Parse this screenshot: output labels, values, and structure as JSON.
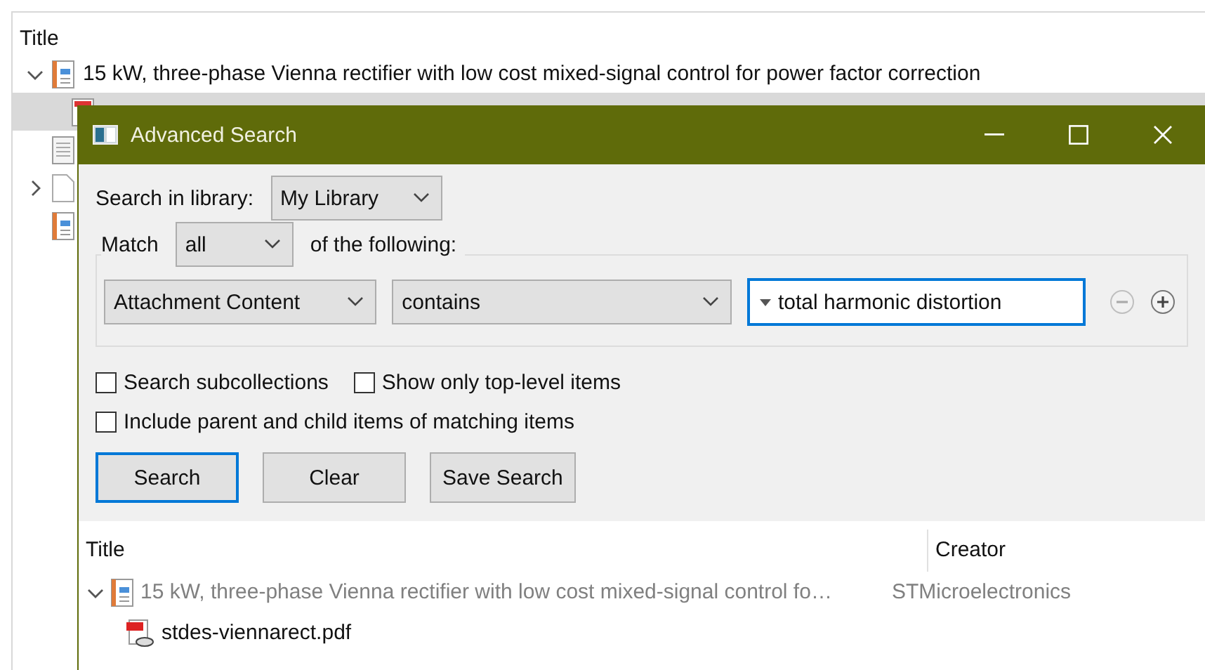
{
  "library": {
    "columns": [
      "Title"
    ],
    "rows": [
      {
        "kind": "report",
        "title": "15 kW, three-phase Vienna rectifier with low cost mixed-signal control for power factor correction",
        "selected": false,
        "expanded": true,
        "children": [
          {
            "kind": "attachment",
            "selected": true
          }
        ]
      },
      {
        "kind": "note",
        "selected": false
      },
      {
        "kind": "document",
        "selected": false,
        "expanded": false
      },
      {
        "kind": "report",
        "selected": false
      }
    ]
  },
  "dialog": {
    "title": "Advanced Search",
    "library_label": "Search in library:",
    "library": "My Library",
    "match_label": "Match",
    "match": "all",
    "match_suffix": "of the following:",
    "condition": {
      "field": "Attachment Content",
      "operator": "contains",
      "value": "total harmonic distortion",
      "buttons": [
        {
          "kind": "remove",
          "disabled": true
        },
        {
          "kind": "add",
          "disabled": false
        }
      ]
    },
    "options": [
      [
        {
          "label": "Search subcollections",
          "checked": false
        },
        {
          "label": "Show only top-level items",
          "checked": false
        }
      ],
      [
        {
          "label": "Include parent and child items of matching items",
          "checked": false
        }
      ]
    ],
    "buttons": [
      {
        "label": "Search",
        "focused": true
      },
      {
        "label": "Clear",
        "focused": false
      },
      {
        "label": "Save Search",
        "focused": false
      }
    ],
    "results": {
      "columns": [
        "Title",
        "Creator"
      ],
      "rows": [
        {
          "kind": "report",
          "title": "15 kW, three-phase Vienna rectifier with low cost mixed-signal control fo…",
          "creator": "STMicroelectronics",
          "matched": false,
          "expanded": true,
          "children": [
            {
              "kind": "pdf",
              "title": "stdes-viennarect.pdf",
              "matched": true
            }
          ]
        }
      ]
    }
  }
}
